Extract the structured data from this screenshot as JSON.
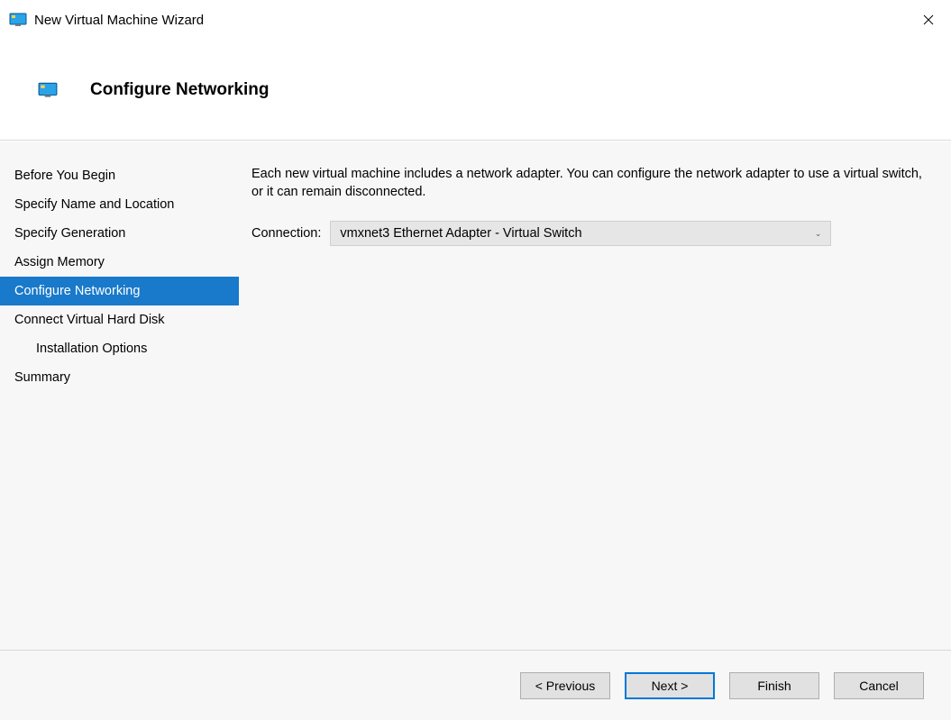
{
  "window": {
    "title": "New Virtual Machine Wizard"
  },
  "header": {
    "page_title": "Configure Networking"
  },
  "sidebar": {
    "items": [
      {
        "label": "Before You Begin",
        "selected": false,
        "indent": false
      },
      {
        "label": "Specify Name and Location",
        "selected": false,
        "indent": false
      },
      {
        "label": "Specify Generation",
        "selected": false,
        "indent": false
      },
      {
        "label": "Assign Memory",
        "selected": false,
        "indent": false
      },
      {
        "label": "Configure Networking",
        "selected": true,
        "indent": false
      },
      {
        "label": "Connect Virtual Hard Disk",
        "selected": false,
        "indent": false
      },
      {
        "label": "Installation Options",
        "selected": false,
        "indent": true
      },
      {
        "label": "Summary",
        "selected": false,
        "indent": false
      }
    ]
  },
  "content": {
    "description": "Each new virtual machine includes a network adapter. You can configure the network adapter to use a virtual switch, or it can remain disconnected.",
    "connection_label": "Connection:",
    "connection_value": "vmxnet3 Ethernet Adapter - Virtual Switch"
  },
  "footer": {
    "previous": "< Previous",
    "next": "Next >",
    "finish": "Finish",
    "cancel": "Cancel"
  }
}
